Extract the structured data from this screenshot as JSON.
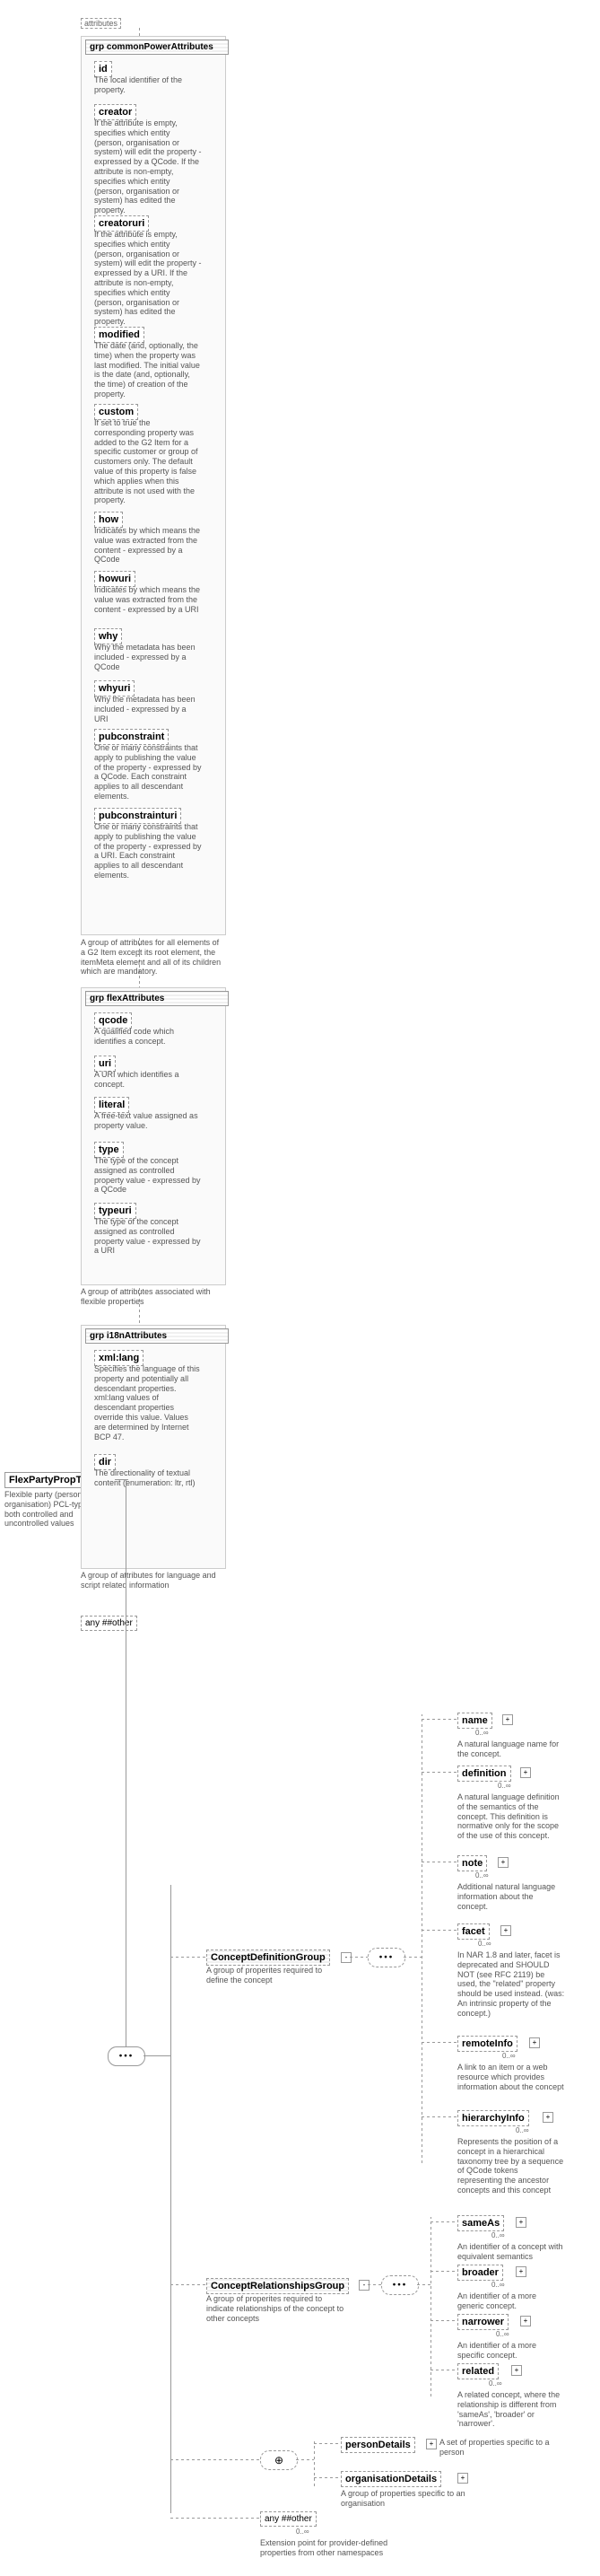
{
  "root": {
    "name": "FlexPartyPropType",
    "desc": "Flexible party (person or organisation) PCL-type for both controlled and uncontrolled values"
  },
  "attr_label": "attributes",
  "groups": {
    "common": {
      "title": "grp  commonPowerAttributes",
      "desc": "A group of attributes for all elements of a G2 Item except its root element, the itemMeta element and all of its children which are mandatory.",
      "items": [
        {
          "name": "id",
          "desc": "The local identifier of the property."
        },
        {
          "name": "creator",
          "desc": "If the attribute is empty, specifies which entity (person, organisation or system) will edit the property - expressed by a QCode. If the attribute is non-empty, specifies which entity (person, organisation or system) has edited the property."
        },
        {
          "name": "creatoruri",
          "desc": "If the attribute is empty, specifies which entity (person, organisation or system) will edit the property - expressed by a URI. If the attribute is non-empty, specifies which entity (person, organisation or system) has edited the property."
        },
        {
          "name": "modified",
          "desc": "The date (and, optionally, the time) when the property was last modified. The initial value is the date (and, optionally, the time) of creation of the property."
        },
        {
          "name": "custom",
          "desc": "If set to true the corresponding property was added to the G2 Item for a specific customer or group of customers only. The default value of this property is false which applies when this attribute is not used with the property."
        },
        {
          "name": "how",
          "desc": "Indicates by which means the value was extracted from the content - expressed by a QCode"
        },
        {
          "name": "howuri",
          "desc": "Indicates by which means the value was extracted from the content - expressed by a URI"
        },
        {
          "name": "why",
          "desc": "Why the metadata has been included - expressed by a QCode"
        },
        {
          "name": "whyuri",
          "desc": "Why the metadata has been included - expressed by a URI"
        },
        {
          "name": "pubconstraint",
          "desc": "One or many constraints that apply to publishing the value of the property - expressed by a QCode. Each constraint applies to all descendant elements."
        },
        {
          "name": "pubconstrainturi",
          "desc": "One or many constraints that apply to publishing the value of the property - expressed by a URI. Each constraint applies to all descendant elements."
        }
      ]
    },
    "flex": {
      "title": "grp  flexAttributes",
      "desc": "A group of attributes associated with flexible properties",
      "items": [
        {
          "name": "qcode",
          "desc": "A qualified code which identifies a concept."
        },
        {
          "name": "uri",
          "desc": "A URI which identifies a concept."
        },
        {
          "name": "literal",
          "desc": "A free-text value assigned as property value."
        },
        {
          "name": "type",
          "desc": "The type of the concept assigned as controlled property value - expressed by a QCode"
        },
        {
          "name": "typeuri",
          "desc": "The type of the concept assigned as controlled property value - expressed by a URI"
        }
      ]
    },
    "i18n": {
      "title": "grp  i18nAttributes",
      "desc": "A group of attributes for language and script related information",
      "items": [
        {
          "name": "xml:lang",
          "desc": "Specifies the language of this property and potentially all descendant properties. xml:lang values of descendant properties override this value. Values are determined by Internet BCP 47."
        },
        {
          "name": "dir",
          "desc": "The directionality of textual content (enumeration: ltr, rtl)"
        }
      ]
    }
  },
  "any_other": "any ##other",
  "concept_def": {
    "name": "ConceptDefinitionGroup",
    "desc": "A group of properites required to define the concept",
    "items": [
      {
        "name": "name",
        "desc": "A natural language name for the concept."
      },
      {
        "name": "definition",
        "desc": "A natural language definition of the semantics of the concept. This definition is normative only for the scope of the use of this concept."
      },
      {
        "name": "note",
        "desc": "Additional natural language information about the concept."
      },
      {
        "name": "facet",
        "desc": "In NAR 1.8 and later, facet is deprecated and SHOULD NOT (see RFC 2119) be used, the \"related\" property should be used instead. (was: An intrinsic property of the concept.)"
      },
      {
        "name": "remoteInfo",
        "desc": "A link to an item or a web resource which provides information about the concept"
      },
      {
        "name": "hierarchyInfo",
        "desc": "Represents the position of a concept in a hierarchical taxonomy tree by a sequence of QCode tokens representing the ancestor concepts and this concept"
      }
    ]
  },
  "concept_rel": {
    "name": "ConceptRelationshipsGroup",
    "desc": "A group of properites required to indicate relationships of the concept to other concepts",
    "items": [
      {
        "name": "sameAs",
        "desc": "An identifier of a concept with equivalent semantics"
      },
      {
        "name": "broader",
        "desc": "An identifier of a more generic concept."
      },
      {
        "name": "narrower",
        "desc": "An identifier of a more specific concept."
      },
      {
        "name": "related",
        "desc": "A related concept, where the relationship is different from 'sameAs', 'broader' or 'narrower'."
      }
    ]
  },
  "details": {
    "person": {
      "name": "personDetails",
      "desc": "A set of properties specific to a person"
    },
    "org": {
      "name": "organisationDetails",
      "desc": "A group of properties specific to an organisation"
    }
  },
  "ext": {
    "label": "any ##other",
    "desc": "Extension point for provider-defined properties from other namespaces"
  },
  "range": "0..∞"
}
